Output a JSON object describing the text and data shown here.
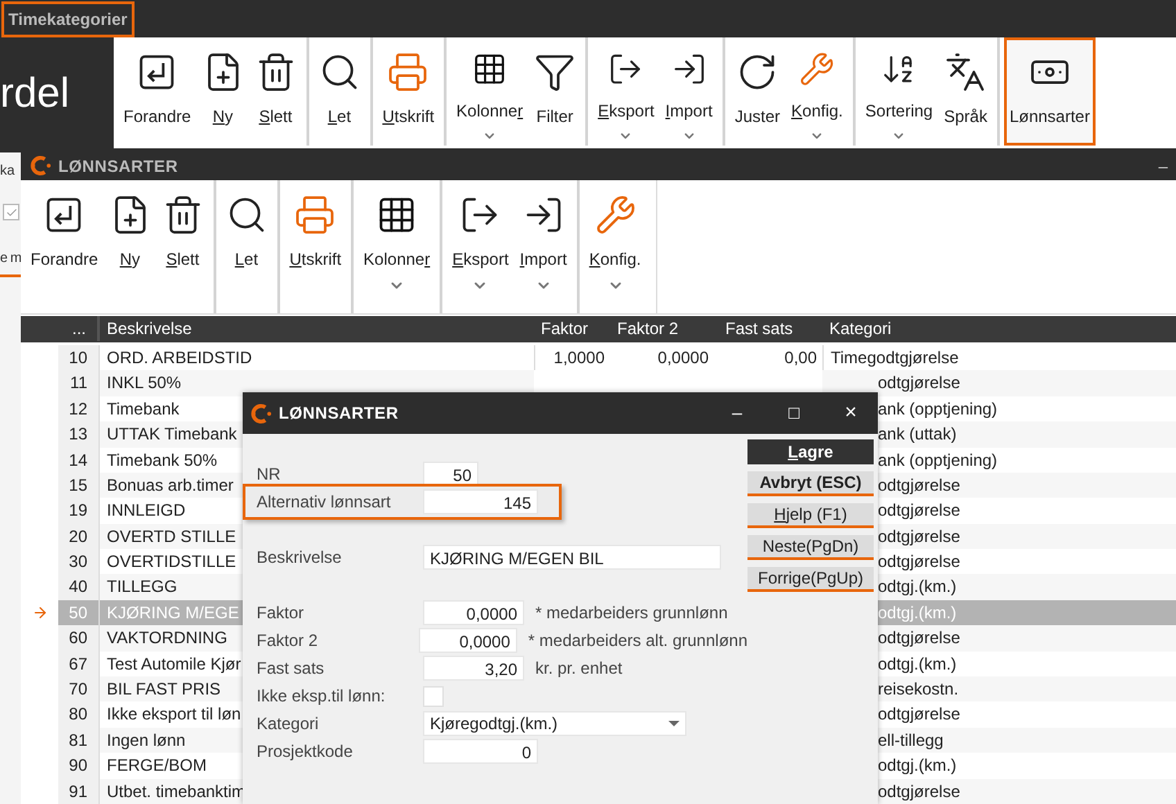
{
  "app_bar": {
    "title": "Timekategorier",
    "highlighted": true
  },
  "logo_text": "rdel",
  "main_toolbar": {
    "groups": [
      [
        {
          "text": "Forandre",
          "menu": false,
          "highlighted": false
        },
        {
          "underlined": "N",
          "text_after": "y",
          "menu": false,
          "highlighted": false
        },
        {
          "underlined": "S",
          "text_after": "lett",
          "menu": false,
          "highlighted": false
        }
      ],
      [
        {
          "underlined": "L",
          "text_after": "et",
          "menu": false,
          "highlighted": false
        }
      ],
      [
        {
          "underlined": "U",
          "text_after": "tskrift",
          "menu": false,
          "highlighted": false
        }
      ],
      [
        {
          "text": "Kolonne",
          "underlined": "r",
          "menu": true,
          "highlighted": false
        },
        {
          "text": "Filter",
          "menu": false,
          "highlighted": false
        }
      ],
      [
        {
          "underlined": "E",
          "text_after": "ksport",
          "menu": true,
          "highlighted": false
        },
        {
          "underlined": "I",
          "text_after": "mport",
          "menu": true,
          "highlighted": false
        }
      ],
      [
        {
          "text": "Juster",
          "menu": false,
          "highlighted": false
        },
        {
          "underlined": "K",
          "text_after": "onfig.",
          "menu": true,
          "highlighted": false
        }
      ],
      [
        {
          "text": "Sortering",
          "menu": true,
          "highlighted": false
        },
        {
          "text": "Språk",
          "menu": false,
          "highlighted": false
        }
      ],
      [
        {
          "text": "Lønnsarter",
          "menu": false,
          "highlighted": true
        }
      ]
    ]
  },
  "background_window": {
    "texts": [
      "ka",
      "e m"
    ],
    "checkbox": {
      "checked": true
    }
  },
  "window": {
    "title": "LØNNSARTER",
    "minimize": "–",
    "toolbar": {
      "groups": [
        [
          {
            "text": "Forandre",
            "menu": false
          },
          {
            "underlined": "N",
            "text_after": "y",
            "menu": false
          },
          {
            "underlined": "S",
            "text_after": "lett",
            "menu": false
          }
        ],
        [
          {
            "underlined": "L",
            "text_after": "et",
            "menu": false
          }
        ],
        [
          {
            "underlined": "U",
            "text_after": "tskrift",
            "menu": false
          }
        ],
        [
          {
            "text": "Kolonne",
            "underlined": "r",
            "menu": true
          }
        ],
        [
          {
            "underlined": "E",
            "text_after": "ksport",
            "menu": true
          },
          {
            "underlined": "I",
            "text_after": "mport",
            "menu": true
          }
        ],
        [
          {
            "underlined": "K",
            "text_after": "onfig.",
            "menu": true
          }
        ]
      ]
    },
    "table": {
      "columns": [
        "...",
        "Beskrivelse",
        "Faktor",
        "Faktor 2",
        "Fast sats",
        "Kategori"
      ],
      "rows": [
        {
          "kind": "full",
          "selected": false,
          "nr": "10",
          "beskrivelse": "ORD. ARBEIDSTID",
          "faktor": "1,0000",
          "faktor_2": "0,0000",
          "fast_sats": "0,00",
          "kategori": "Timegodtgjørelse"
        },
        {
          "kind": "covered",
          "selected": false,
          "nr": "11",
          "beskrivelse": "INKL 50%",
          "kategori": "odtgjørelse"
        },
        {
          "kind": "covered",
          "selected": false,
          "nr": "12",
          "beskrivelse": "Timebank",
          "kategori": "ank (opptjening)"
        },
        {
          "kind": "covered",
          "selected": false,
          "nr": "13",
          "beskrivelse": "UTTAK Timebank",
          "kategori": "ank (uttak)"
        },
        {
          "kind": "covered",
          "selected": false,
          "nr": "14",
          "beskrivelse": "Timebank 50%",
          "kategori": "ank (opptjening)"
        },
        {
          "kind": "covered",
          "selected": false,
          "nr": "15",
          "beskrivelse": "Bonuas arb.timer",
          "kategori": "odtgjørelse"
        },
        {
          "kind": "covered",
          "selected": false,
          "nr": "19",
          "beskrivelse": "INNLEIGD",
          "kategori": "odtgjørelse"
        },
        {
          "kind": "covered",
          "selected": false,
          "nr": "20",
          "beskrivelse": "OVERTD STILLE",
          "kategori": "odtgjørelse"
        },
        {
          "kind": "covered",
          "selected": false,
          "nr": "30",
          "beskrivelse": "OVERTIDSTILLE",
          "kategori": "odtgjørelse"
        },
        {
          "kind": "covered",
          "selected": false,
          "nr": "40",
          "beskrivelse": "TILLEGG",
          "kategori": "odtgj.(km.)"
        },
        {
          "kind": "covered",
          "selected": true,
          "nr": "50",
          "beskrivelse": "KJØRING M/EGE",
          "kategori": "odtgj.(km.)"
        },
        {
          "kind": "covered",
          "selected": false,
          "nr": "60",
          "beskrivelse": "VAKTORDNING",
          "kategori": "odtgjørelse"
        },
        {
          "kind": "covered",
          "selected": false,
          "nr": "67",
          "beskrivelse": "Test Automile Kjør",
          "kategori": "odtgj.(km.)"
        },
        {
          "kind": "covered",
          "selected": false,
          "nr": "70",
          "beskrivelse": "BIL  FAST PRIS",
          "kategori": "reisekostn."
        },
        {
          "kind": "covered",
          "selected": false,
          "nr": "80",
          "beskrivelse": "Ikke eksport til løn",
          "kategori": "odtgjørelse"
        },
        {
          "kind": "covered",
          "selected": false,
          "nr": "81",
          "beskrivelse": "Ingen lønn",
          "kategori": "ell-tillegg"
        },
        {
          "kind": "covered",
          "selected": false,
          "nr": "90",
          "beskrivelse": "FERGE/BOM",
          "kategori": "odtgj.(km.)"
        },
        {
          "kind": "covered",
          "selected": false,
          "nr": "91",
          "beskrivelse": "Utbet. timebanktim",
          "kategori": "odtgjørelse"
        }
      ]
    }
  },
  "dialog": {
    "title": "LØNNSARTER",
    "controls": [
      "–",
      "□",
      "×"
    ],
    "field_groups": [
      [
        {
          "kind": "small_number",
          "label": "NR",
          "value": "50",
          "highlighted": false
        },
        {
          "kind": "number",
          "label": "Alternativ lønnsart",
          "value": "145",
          "highlighted": true
        }
      ],
      [
        {
          "kind": "text",
          "label": "Beskrivelse",
          "value": "KJØRING M/EGEN BIL",
          "highlighted": false
        }
      ],
      [
        {
          "kind": "decimal",
          "label": "Faktor",
          "value": "0,0000",
          "note": "* medarbeiders grunnlønn",
          "highlighted": false
        },
        {
          "kind": "decimal",
          "label": "Faktor 2",
          "value": "0,0000",
          "note": "* medarbeiders alt. grunnlønn",
          "highlighted": false
        },
        {
          "kind": "decimal",
          "label": "Fast sats",
          "value": "3,20",
          "note": "kr. pr. enhet",
          "highlighted": false
        },
        {
          "kind": "checkbox",
          "label": "Ikke eksp.til lønn:",
          "checked": false,
          "highlighted": false
        },
        {
          "kind": "select",
          "label": "Kategori",
          "value": "Kjøregodtgj.(km.)",
          "highlighted": false
        },
        {
          "kind": "number",
          "label": "Prosjektkode",
          "value": "0",
          "highlighted": false
        }
      ]
    ],
    "buttons": [
      {
        "underlined": "L",
        "text_after": "agre",
        "kind": "primary"
      },
      {
        "text": "Avbryt (ESC)",
        "kind": "bold"
      },
      {
        "underlined": "H",
        "text_after": "jelp (F1)",
        "kind": "normal"
      },
      {
        "text": "Neste(PgDn)",
        "kind": "normal"
      },
      {
        "text": "Forrige(PgUp)",
        "kind": "normal"
      }
    ]
  }
}
